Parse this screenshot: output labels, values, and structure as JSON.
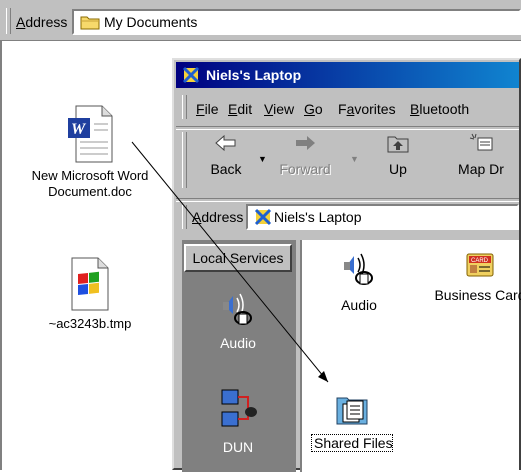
{
  "outer_address": {
    "label_accel": "A",
    "label_rest": "ddress",
    "value": "My Documents",
    "icon": "folder-icon"
  },
  "desktop_icons": [
    {
      "label_line1": "New Microsoft Word",
      "label_line2": "Document.doc",
      "icon": "word-document-icon"
    },
    {
      "label_line1": "~ac3243b.tmp",
      "icon": "windows-file-icon"
    }
  ],
  "window": {
    "title": "Niels's Laptop",
    "title_icon": "laptop-icon",
    "menu": [
      {
        "accel": "F",
        "rest": "ile"
      },
      {
        "accel": "E",
        "rest": "dit"
      },
      {
        "accel": "V",
        "rest": "iew"
      },
      {
        "accel": "G",
        "rest": "o"
      },
      {
        "pre": "F",
        "accel": "a",
        "rest": "vorites"
      },
      {
        "accel": "B",
        "rest": "luetooth"
      }
    ],
    "toolbar": [
      {
        "label": "Back",
        "icon": "back-arrow-icon",
        "disabled": false
      },
      {
        "label": "Forward",
        "icon": "forward-arrow-icon",
        "disabled": true
      },
      {
        "label": "Up",
        "icon": "up-folder-icon",
        "disabled": false
      },
      {
        "label": "Map Dr",
        "icon": "map-drive-icon",
        "disabled": false
      }
    ],
    "address": {
      "label_accel": "A",
      "label_rest": "ddress",
      "value": "Niels's Laptop",
      "icon": "laptop-icon"
    },
    "left_pane": {
      "header": "Local Services",
      "items": [
        {
          "label": "Audio",
          "icon": "audio-headset-icon"
        },
        {
          "label": "DUN",
          "icon": "dial-up-network-icon"
        }
      ]
    },
    "right_pane": {
      "items": [
        {
          "label": "Audio",
          "icon": "audio-headset-icon"
        },
        {
          "label": "Business Card",
          "icon": "business-card-icon"
        },
        {
          "label": "Shared Files",
          "icon": "shared-files-folder-icon"
        }
      ]
    }
  },
  "colors": {
    "titlebar_start": "#000080",
    "titlebar_end": "#1084d0",
    "chrome": "#c0c0c0",
    "pane": "#808080"
  }
}
